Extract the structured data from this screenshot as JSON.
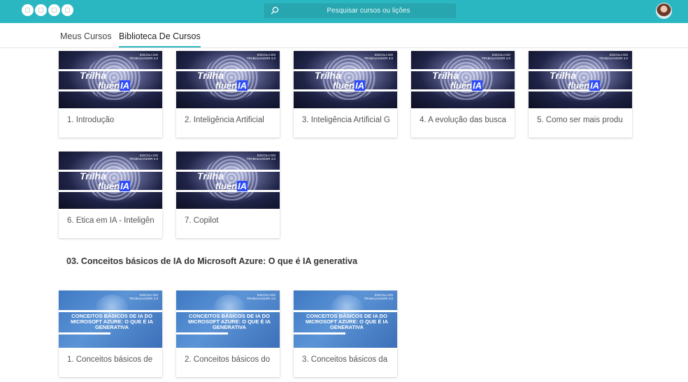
{
  "header": {
    "search_placeholder": "Pesquisar cursos ou lições",
    "accent": "#2ab7c1"
  },
  "tabs": [
    {
      "label": "Meus Cursos",
      "active": false
    },
    {
      "label": "Biblioteca De Cursos",
      "active": true
    }
  ],
  "thumb_ia": {
    "logo": "ESCOLA DO TRABALHADOR 4.0",
    "line1": "Trilha",
    "line2_prefix": "fluên",
    "line2_highlight": "IA"
  },
  "thumb_az": {
    "logo": "ESCOLA DO TRABALHADOR 4.0",
    "text": "CONCEITOS BÁSICOS DE IA DO MICROSOFT AZURE: O QUE É IA GENERATIVA"
  },
  "trilha_lessons": [
    "1. Introdução",
    "2. Inteligência Artificial",
    "3. Inteligência Artificial G",
    "4. A evolução das busca",
    "5. Como ser mais produ",
    "6. Ética em IA - Inteligên",
    "7. Copilot"
  ],
  "section": {
    "title": "03. Conceitos básicos de IA do Microsoft Azure: O que é IA generativa",
    "lessons": [
      "1. Conceitos básicos de",
      "2. Conceitos básicos do",
      "3. Conceitos básicos da"
    ]
  }
}
